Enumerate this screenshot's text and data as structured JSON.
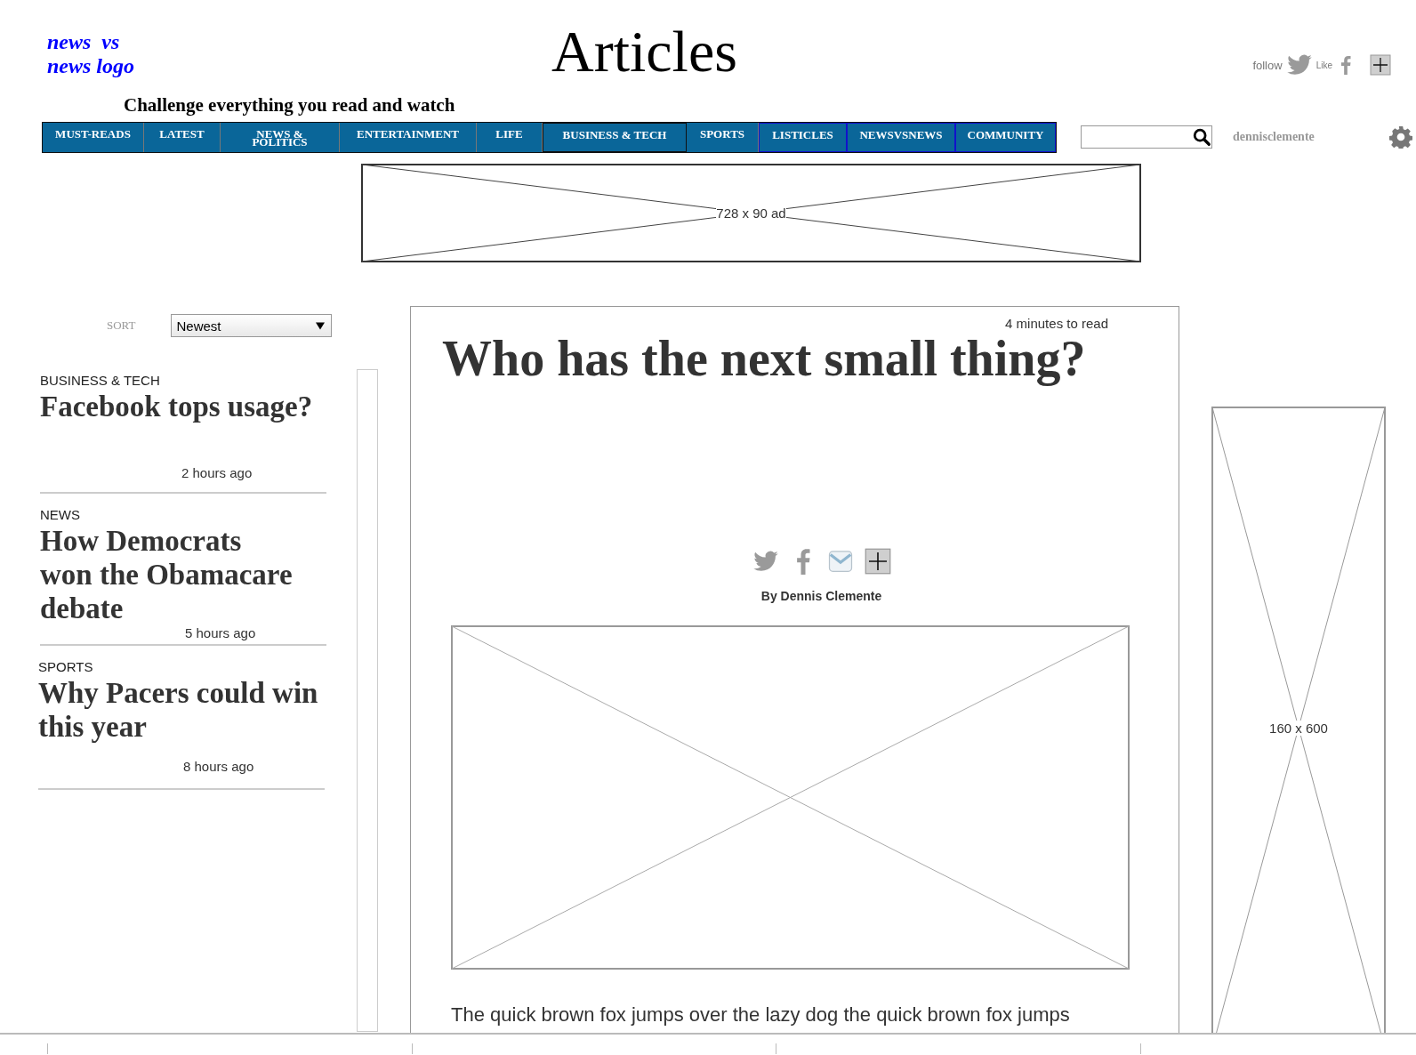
{
  "logo": {
    "lines": [
      "news  vs",
      "news logo"
    ]
  },
  "page_title": "Articles",
  "tagline": "Challenge everything you read and watch",
  "social": {
    "follow_label": "follow",
    "like_label": "Like"
  },
  "nav": {
    "items": [
      {
        "label": "MUST-READS"
      },
      {
        "label": "LATEST"
      },
      {
        "label": "NEWS & POLITICS"
      },
      {
        "label": "ENTERTAINMENT"
      },
      {
        "label": "LIFE"
      },
      {
        "label": "BUSINESS & TECH"
      },
      {
        "label": "SPORTS"
      },
      {
        "label": "LISTICLES"
      },
      {
        "label": "NEWSVSNEWS"
      },
      {
        "label": "COMMUNITY"
      }
    ]
  },
  "user": {
    "name": "dennisclemente"
  },
  "top_ad": {
    "label": "728 x 90 ad"
  },
  "sort": {
    "label": "SORT",
    "value": "Newest"
  },
  "articles": [
    {
      "category": "BUSINESS  & TECH",
      "title": "Facebook tops usage?",
      "time": "2 hours ago"
    },
    {
      "category": "NEWS",
      "title": "How Democrats won the Obamacare debate",
      "time": "5 hours ago"
    },
    {
      "category": "SPORTS",
      "title": "Why Pacers could win this year",
      "time": "8 hours ago"
    }
  ],
  "main": {
    "read_time": "4 minutes to read",
    "title": "Who has the next small thing?",
    "byline": "By Dennis Clemente",
    "body": [
      "The quick brown fox jumps over the lazy dog the quick brown fox jumps"
    ]
  },
  "side_ad": {
    "label": "160 x 600"
  }
}
